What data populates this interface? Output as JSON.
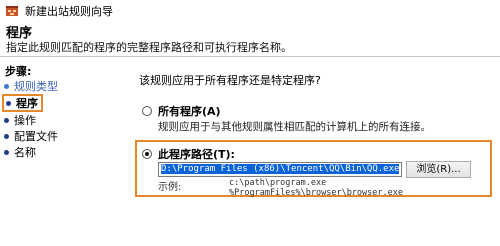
{
  "window": {
    "title": "新建出站规则向导"
  },
  "header": {
    "title": "程序",
    "subtitle": "指定此规则匹配的程序的完整程序路径和可执行程序名称。"
  },
  "sidebar": {
    "title": "步骤:",
    "items": [
      {
        "label": "规则类型",
        "state": "done"
      },
      {
        "label": "程序",
        "state": "current"
      },
      {
        "label": "操作",
        "state": "pending"
      },
      {
        "label": "配置文件",
        "state": "pending"
      },
      {
        "label": "名称",
        "state": "pending"
      }
    ]
  },
  "main": {
    "question": "该规则应用于所有程序还是特定程序?",
    "option_all": {
      "label": "所有程序(A)",
      "description": "规则应用于与其他规则属性相匹配的计算机上的所有连接。",
      "checked": false
    },
    "option_path": {
      "label": "此程序路径(T):",
      "checked": true,
      "value": "D:\\Program Files (x86)\\Tencent\\QQ\\Bin\\QQ.exe",
      "browse_label": "浏览(R)...",
      "example_label": "示例:",
      "examples": [
        "c:\\path\\program.exe",
        "%ProgramFiles%\\browser\\browser.exe"
      ]
    }
  },
  "colors": {
    "highlight": "#e6882a",
    "selection": "#0a64d8"
  }
}
